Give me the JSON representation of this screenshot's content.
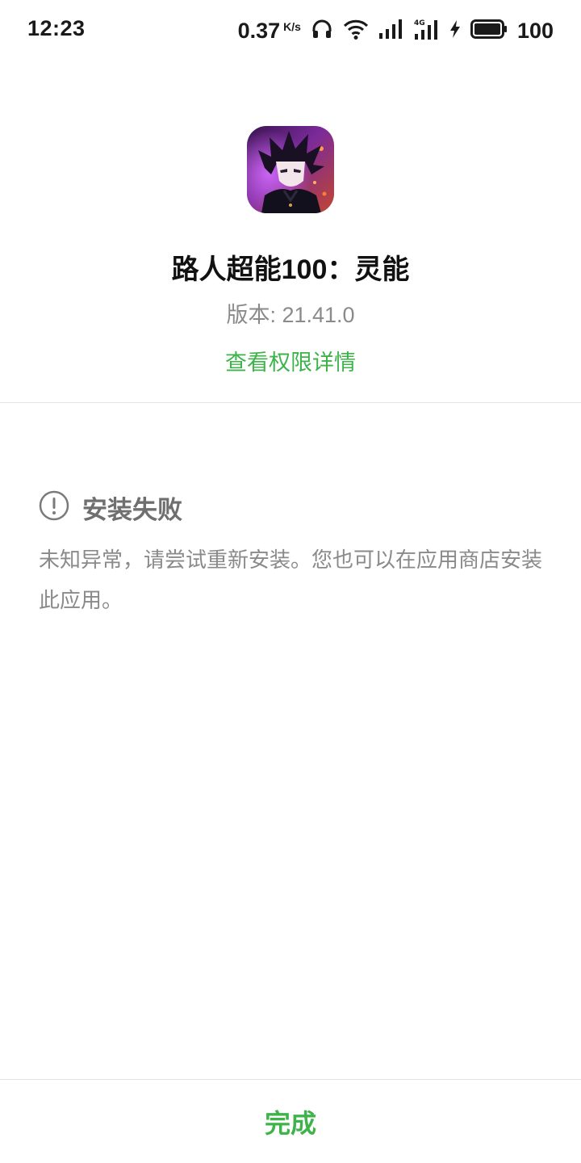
{
  "status_bar": {
    "time": "12:23",
    "net_speed": "0.37",
    "net_speed_unit": "K/s",
    "network_type": "4G",
    "battery_level": "100",
    "icons": [
      "headphones-icon",
      "wifi-icon",
      "signal-icon",
      "signal-4g-icon",
      "charging-icon",
      "battery-icon"
    ]
  },
  "app": {
    "name": "路人超能100：灵能",
    "version": "版本: 21.41.0",
    "permission_link": "查看权限详情"
  },
  "failure": {
    "title": "安装失败",
    "message": "未知异常，请尝试重新安装。您也可以在应用商店安装此应用。",
    "icon": "exclamation-circle-icon"
  },
  "footer": {
    "done_label": "完成"
  },
  "colors": {
    "accent_green": "#3db34a",
    "text_primary": "#111111",
    "text_secondary": "#8a8a8a",
    "divider": "#e3e3e3"
  }
}
